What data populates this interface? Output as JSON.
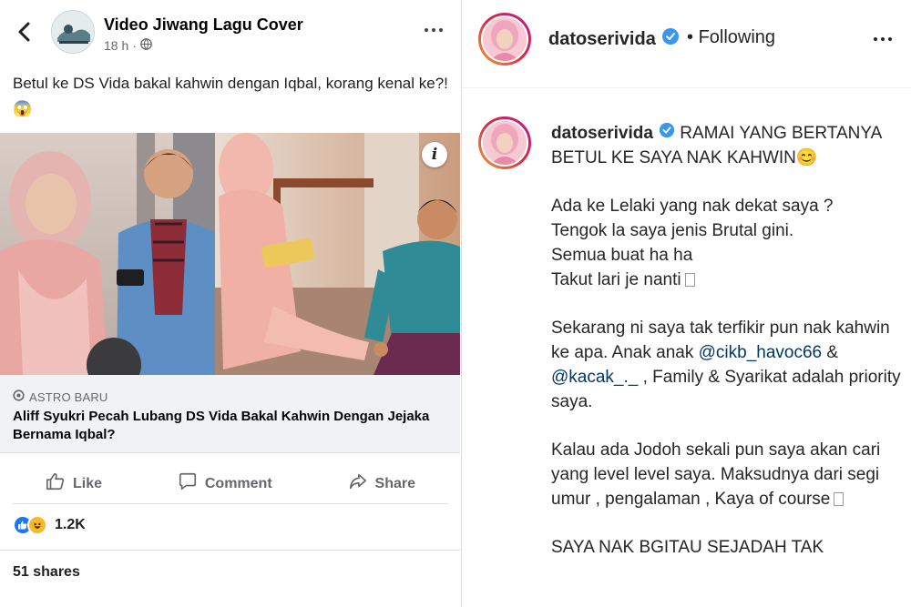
{
  "facebook": {
    "page_name": "Video Jiwang Lagu Cover",
    "time": "18 h",
    "caption": "Betul ke DS Vida bakal kahwin dengan Iqbal, korang kenal ke?!😱",
    "link_source": "ASTRO BARU",
    "link_headline": "Aliff Syukri Pecah Lubang DS Vida Bakal Kahwin Dengan Jejaka Bernama Iqbal?",
    "actions": {
      "like": "Like",
      "comment": "Comment",
      "share": "Share"
    },
    "reaction_count": "1.2K",
    "shares": "51 shares",
    "icons": [
      "back-icon",
      "globe-icon",
      "more-icon",
      "info-icon",
      "like-icon",
      "comment-icon",
      "share-icon"
    ],
    "colors": {
      "like_blue": "#1877f2",
      "haha_yellow": "#f7b928"
    }
  },
  "instagram": {
    "username": "datoserivida",
    "follow_status": "Following",
    "caption_first": "RAMAI YANG BERTANYA BETUL KE SAYA NAK KAHWIN😊",
    "paragraph2": [
      "Ada ke Lelaki yang nak dekat saya ?",
      "Tengok la saya jenis Brutal gini.",
      "Semua buat ha ha",
      "Takut lari je nanti"
    ],
    "paragraph3_start": "Sekarang ni saya tak terfikir pun nak kahwin ke apa. Anak anak",
    "mention1": "@cikb_havoc66",
    "amp": "&",
    "mention2": "@kacak_._",
    "paragraph3_end": ", Family & Syarikat adalah priority saya.",
    "paragraph4": "Kalau ada Jodoh sekali pun saya akan cari yang level level saya. Maksudnya dari segi umur , pengalaman , Kaya of course",
    "paragraph5": "SAYA NAK BGITAU SEJADAH TAK",
    "icons": [
      "verified-badge-icon",
      "more-icon"
    ],
    "colors": {
      "verified_blue": "#3897f0",
      "mention": "#00376b"
    }
  }
}
